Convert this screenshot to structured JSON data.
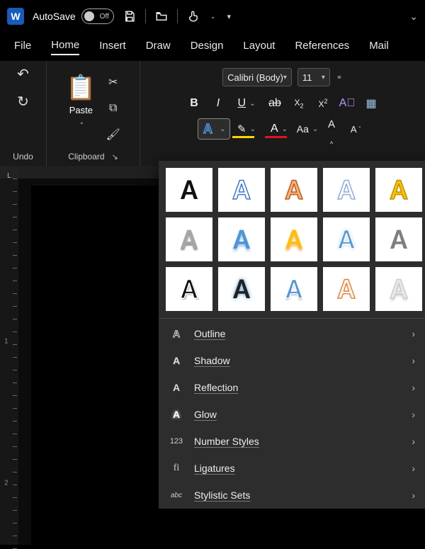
{
  "titlebar": {
    "autosave_label": "AutoSave",
    "autosave_state": "Off"
  },
  "tabs": [
    "File",
    "Home",
    "Insert",
    "Draw",
    "Design",
    "Layout",
    "References",
    "Mail"
  ],
  "active_tab": "Home",
  "ribbon": {
    "undo_caption": "Undo",
    "clipboard_caption": "Clipboard",
    "paste_label": "Paste",
    "font_name": "Calibri (Body)",
    "font_size": "11"
  },
  "ruler": {
    "corner": "L",
    "v_labels": [
      "1",
      "2"
    ]
  },
  "text_effects": {
    "styles": [
      {
        "fill": "#111",
        "stroke": "none",
        "shadow": "none"
      },
      {
        "fill": "none",
        "stroke": "#3b78d8",
        "shadow": "none"
      },
      {
        "fill": "#f4b183",
        "stroke": "#c55a11",
        "shadow": "none"
      },
      {
        "fill": "none",
        "stroke": "#8faadc",
        "shadow": "none"
      },
      {
        "fill": "#ffc000",
        "stroke": "#bf9000",
        "shadow": "none"
      },
      {
        "fill": "#a6a6a6",
        "stroke": "none",
        "shadow": "0 2px 2px #888"
      },
      {
        "fill": "#4e95d9",
        "stroke": "none",
        "shadow": "0 3px 3px #9cc3e6"
      },
      {
        "fill": "#ffc000",
        "stroke": "none",
        "shadow": "0 3px 3px #f4b183"
      },
      {
        "fill": "#5b9bd5",
        "stroke": "#fff",
        "shadow": "0 0 4px #9cc3e6"
      },
      {
        "fill": "#808080",
        "stroke": "none",
        "shadow": "none"
      },
      {
        "fill": "#111",
        "stroke": "#fff",
        "shadow": "2px 2px 0 #bbb"
      },
      {
        "fill": "#222",
        "stroke": "none",
        "shadow": "0 0 6px #5b9bd5"
      },
      {
        "fill": "#4e95d9",
        "stroke": "#fff",
        "shadow": "0 2px 2px #aaa"
      },
      {
        "fill": "none",
        "stroke": "#ed7d31",
        "shadow": "none"
      },
      {
        "fill": "#eaeaea",
        "stroke": "#ccc",
        "shadow": "0 3px 3px #ccc"
      }
    ],
    "menu": [
      {
        "icon": "A-outline",
        "label": "Outline"
      },
      {
        "icon": "A-shadow",
        "label": "Shadow"
      },
      {
        "icon": "A-reflect",
        "label": "Reflection"
      },
      {
        "icon": "A-glow",
        "label": "Glow"
      },
      {
        "icon": "123",
        "label": "Number Styles"
      },
      {
        "icon": "fi",
        "label": "Ligatures"
      },
      {
        "icon": "abc",
        "label": "Stylistic Sets"
      }
    ]
  }
}
